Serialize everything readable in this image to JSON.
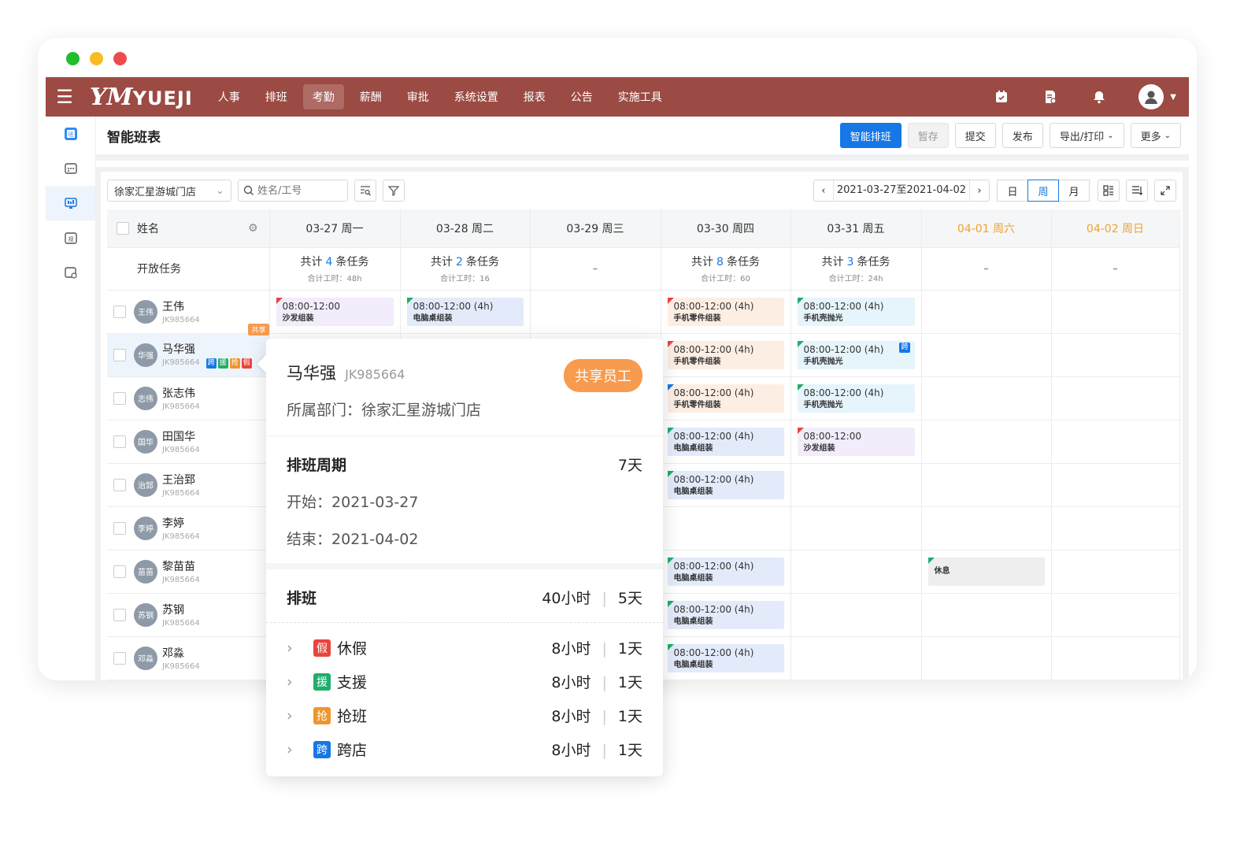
{
  "nav": {
    "logo_script": "YM",
    "logo_word": "YUEJI",
    "items": [
      {
        "label": "人事"
      },
      {
        "label": "排班"
      },
      {
        "label": "考勤",
        "active": true
      },
      {
        "label": "薪酬"
      },
      {
        "label": "审批"
      },
      {
        "label": "系统设置"
      },
      {
        "label": "报表"
      },
      {
        "label": "公告"
      },
      {
        "label": "实施工具"
      }
    ],
    "icons": [
      "calendar-check-icon",
      "document-icon",
      "bell-icon",
      "user-avatar-icon"
    ]
  },
  "page": {
    "title": "智能班表",
    "buttons": {
      "smart": "智能排班",
      "draft": "暂存",
      "submit": "提交",
      "publish": "发布",
      "export": "导出/打印",
      "more": "更多"
    }
  },
  "toolbar": {
    "store": "徐家汇星游城门店",
    "search_placeholder": "姓名/工号",
    "date_range": "2021-03-27至2021-04-02",
    "views": [
      "日",
      "周",
      "月"
    ],
    "active_view": "周"
  },
  "table": {
    "name_header": "姓名",
    "days": [
      {
        "label": "03-27  周一",
        "weekend": false
      },
      {
        "label": "03-28  周二",
        "weekend": false
      },
      {
        "label": "03-29  周三",
        "weekend": false
      },
      {
        "label": "03-30  周四",
        "weekend": false
      },
      {
        "label": "03-31  周五",
        "weekend": false
      },
      {
        "label": "04-01  周六",
        "weekend": true
      },
      {
        "label": "04-02  周日",
        "weekend": true
      }
    ],
    "open_tasks": {
      "label": "开放任务",
      "prefix": "共计",
      "suffix": "条任务",
      "hours_label": "合计工时：",
      "cells": [
        {
          "count": "4",
          "hours": "48h"
        },
        {
          "count": "2",
          "hours": "16"
        },
        {
          "empty": "–"
        },
        {
          "count": "8",
          "hours": "60"
        },
        {
          "count": "3",
          "hours": "24h"
        },
        {
          "empty": "–"
        },
        {
          "empty": "–"
        }
      ]
    },
    "employees": [
      {
        "name": "王伟",
        "avatar": "王伟",
        "id": "JK985664"
      },
      {
        "name": "马华强",
        "avatar": "华强",
        "id": "JK985664",
        "shared_tag": "共享",
        "tags": [
          "跨",
          "援",
          "抢",
          "假"
        ]
      },
      {
        "name": "张志伟",
        "avatar": "志伟",
        "id": "JK985664"
      },
      {
        "name": "田国华",
        "avatar": "国华",
        "id": "JK985664"
      },
      {
        "name": "王治郅",
        "avatar": "治郅",
        "id": "JK985664"
      },
      {
        "name": "李婷",
        "avatar": "李婷",
        "id": "JK985664"
      },
      {
        "name": "黎苗苗",
        "avatar": "苗苗",
        "id": "JK985664"
      },
      {
        "name": "苏钢",
        "avatar": "苏钢",
        "id": "JK985664"
      },
      {
        "name": "邓淼",
        "avatar": "邓淼",
        "id": "JK985664"
      }
    ],
    "shifts": [
      [
        {
          "time": "08:00-12:00",
          "task": "沙发组装",
          "bg": "#f2ecfb",
          "flag": "#e8453c"
        },
        {
          "time": "08:00-12:00  (4h)",
          "task": "电脑桌组装",
          "bg": "#e3ebfb",
          "flag": "#1fae6b"
        },
        null,
        {
          "time": "08:00-12:00  (4h)",
          "task": "手机零件组装",
          "bg": "#fdeee4",
          "flag": "#e8453c"
        },
        {
          "time": "08:00-12:00  (4h)",
          "task": "手机壳抛光",
          "bg": "#e6f4fb",
          "flag": "#1fae6b"
        },
        null,
        null
      ],
      [
        null,
        null,
        null,
        {
          "time": "08:00-12:00  (4h)",
          "task": "手机零件组装",
          "bg": "#fdeee4",
          "flag": "#e8453c"
        },
        {
          "time": "08:00-12:00  (4h)",
          "task": "手机壳抛光",
          "bg": "#e6f4fb",
          "flag": "#1fae6b",
          "badge": "跨"
        },
        null,
        null
      ],
      [
        null,
        null,
        null,
        {
          "time": "08:00-12:00  (4h)",
          "task": "手机零件组装",
          "bg": "#fdeee4",
          "flag": "#1677e6"
        },
        {
          "time": "08:00-12:00  (4h)",
          "task": "手机壳抛光",
          "bg": "#e6f4fb",
          "flag": "#1fae6b"
        },
        null,
        null
      ],
      [
        null,
        null,
        null,
        {
          "time": "08:00-12:00  (4h)",
          "task": "电脑桌组装",
          "bg": "#e3ebfb",
          "flag": "#1fae6b"
        },
        {
          "time": "08:00-12:00",
          "task": "沙发组装",
          "bg": "#f2ecfb",
          "flag": "#e8453c"
        },
        null,
        null
      ],
      [
        null,
        null,
        null,
        {
          "time": "08:00-12:00  (4h)",
          "task": "电脑桌组装",
          "bg": "#e3ebfb",
          "flag": "#1fae6b"
        },
        null,
        null,
        null
      ],
      [
        null,
        null,
        null,
        null,
        null,
        null,
        null
      ],
      [
        null,
        null,
        null,
        {
          "time": "08:00-12:00  (4h)",
          "task": "电脑桌组装",
          "bg": "#e3ebfb",
          "flag": "#1fae6b"
        },
        null,
        {
          "time": "",
          "task": "休息",
          "bg": "#eeeeee",
          "flag": "#1fae6b"
        },
        null
      ],
      [
        null,
        null,
        null,
        {
          "time": "08:00-12:00  (4h)",
          "task": "电脑桌组装",
          "bg": "#e3ebfb",
          "flag": "#1fae6b"
        },
        null,
        null,
        null
      ],
      [
        null,
        null,
        null,
        {
          "time": "08:00-12:00  (4h)",
          "task": "电脑桌组装",
          "bg": "#e3ebfb",
          "flag": "#1fae6b"
        },
        null,
        null,
        null
      ]
    ]
  },
  "popover": {
    "name": "马华强",
    "id": "JK985664",
    "badge": "共享员工",
    "dept_label": "所属部门：",
    "dept": "徐家汇星游城门店",
    "period_label": "排班周期",
    "period_days": "7天",
    "start_label": "开始：",
    "start": "2021-03-27",
    "end_label": "结束：",
    "end": "2021-04-02",
    "schedule_label": "排班",
    "schedule_hours": "40小时",
    "schedule_days": "5天",
    "items": [
      {
        "icon": "假",
        "label": "休假",
        "hours": "8小时",
        "days": "1天",
        "color": "#e8453c"
      },
      {
        "icon": "援",
        "label": "支援",
        "hours": "8小时",
        "days": "1天",
        "color": "#1fae6b"
      },
      {
        "icon": "抢",
        "label": "抢班",
        "hours": "8小时",
        "days": "1天",
        "color": "#f0952c"
      },
      {
        "icon": "跨",
        "label": "跨店",
        "hours": "8小时",
        "days": "1天",
        "color": "#1677e6"
      }
    ]
  },
  "colors": {
    "nav_bg": "#9b4b43",
    "primary": "#1677e6",
    "weekend": "#f0a12c",
    "shared": "#f79b4f"
  }
}
